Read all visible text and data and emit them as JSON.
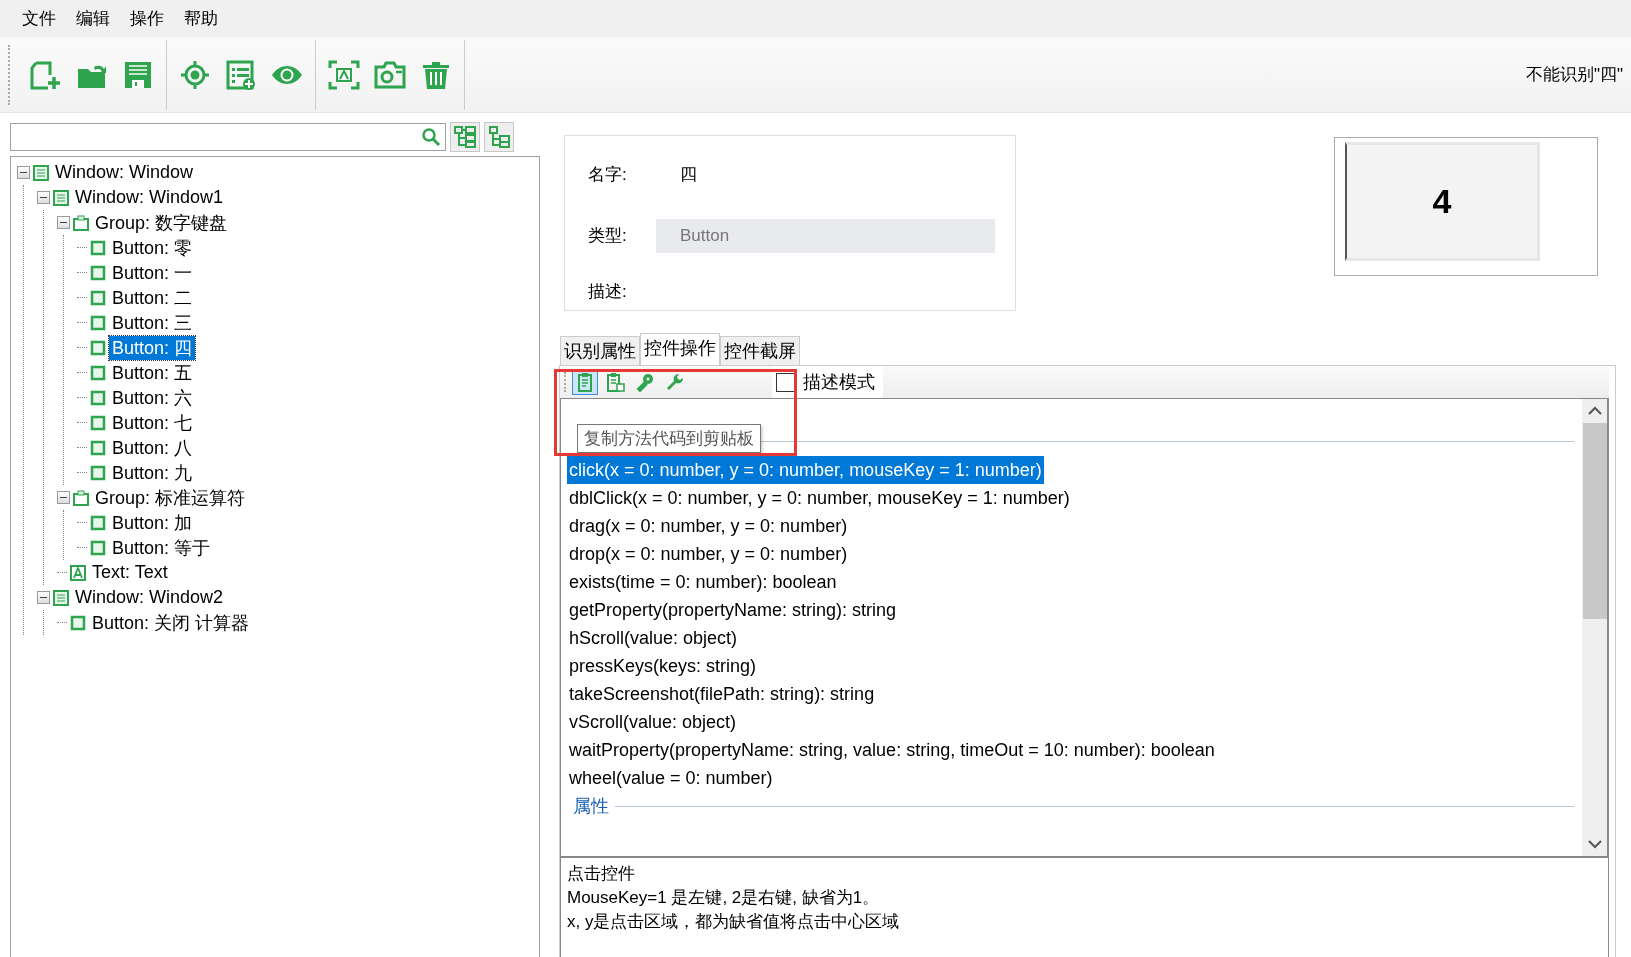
{
  "menu": [
    {
      "label": "文件"
    },
    {
      "label": "编辑"
    },
    {
      "label": "操作"
    },
    {
      "label": "帮助"
    }
  ],
  "status_text": "不能识别\"四\"",
  "tree": [
    {
      "label": "Window: Window",
      "kind": "window",
      "expanded": true,
      "selected": false,
      "children": [
        {
          "label": "Window: Window1",
          "kind": "window",
          "expanded": true,
          "selected": false,
          "children": [
            {
              "label": "Group: 数字键盘",
              "kind": "group",
              "expanded": true,
              "selected": false,
              "children": [
                {
                  "label": "Button: 零",
                  "kind": "button",
                  "selected": false
                },
                {
                  "label": "Button: 一",
                  "kind": "button",
                  "selected": false
                },
                {
                  "label": "Button: 二",
                  "kind": "button",
                  "selected": false
                },
                {
                  "label": "Button: 三",
                  "kind": "button",
                  "selected": false
                },
                {
                  "label": "Button: 四",
                  "kind": "button",
                  "selected": true
                },
                {
                  "label": "Button: 五",
                  "kind": "button",
                  "selected": false
                },
                {
                  "label": "Button: 六",
                  "kind": "button",
                  "selected": false
                },
                {
                  "label": "Button: 七",
                  "kind": "button",
                  "selected": false
                },
                {
                  "label": "Button: 八",
                  "kind": "button",
                  "selected": false
                },
                {
                  "label": "Button: 九",
                  "kind": "button",
                  "selected": false
                }
              ]
            },
            {
              "label": "Group: 标准运算符",
              "kind": "group",
              "expanded": true,
              "selected": false,
              "children": [
                {
                  "label": "Button: 加",
                  "kind": "button",
                  "selected": false
                },
                {
                  "label": "Button: 等于",
                  "kind": "button",
                  "selected": false
                }
              ]
            },
            {
              "label": "Text: Text",
              "kind": "text",
              "selected": false
            }
          ]
        },
        {
          "label": "Window: Window2",
          "kind": "window",
          "expanded": true,
          "selected": false,
          "children": [
            {
              "label": "Button: 关闭 计算器",
              "kind": "button",
              "selected": false
            }
          ]
        }
      ]
    }
  ],
  "details": {
    "name_label": "名字:",
    "name_value": "四",
    "type_label": "类型:",
    "type_value": "Button",
    "desc_label": "描述:"
  },
  "preview": {
    "caption": "4"
  },
  "tabs": [
    {
      "label": "识别属性",
      "selected": false
    },
    {
      "label": "控件操作",
      "selected": true
    },
    {
      "label": "控件截屏",
      "selected": false
    }
  ],
  "method_tools": [
    {
      "hovered": true
    },
    {
      "hovered": false
    },
    {
      "hovered": false
    },
    {
      "hovered": false
    }
  ],
  "describe_mode": {
    "label": "描述模式",
    "checked": false
  },
  "tooltip": "复制方法代码到剪贴板",
  "methods": [
    {
      "text": "click(x = 0: number, y = 0: number, mouseKey = 1: number)",
      "selected": true
    },
    {
      "text": "dblClick(x = 0: number, y = 0: number, mouseKey = 1: number)",
      "selected": false
    },
    {
      "text": "drag(x = 0: number, y = 0: number)",
      "selected": false
    },
    {
      "text": "drop(x = 0: number, y = 0: number)",
      "selected": false
    },
    {
      "text": "exists(time = 0: number): boolean",
      "selected": false
    },
    {
      "text": "getProperty(propertyName: string): string",
      "selected": false
    },
    {
      "text": "hScroll(value: object)",
      "selected": false
    },
    {
      "text": "pressKeys(keys: string)",
      "selected": false
    },
    {
      "text": "takeScreenshot(filePath: string): string",
      "selected": false
    },
    {
      "text": "vScroll(value: object)",
      "selected": false
    },
    {
      "text": "waitProperty(propertyName: string, value: string, timeOut = 10: number): boolean",
      "selected": false
    },
    {
      "text": "wheel(value = 0: number)",
      "selected": false
    }
  ],
  "properties_header": "属性",
  "description_lines": [
    "点击控件",
    "MouseKey=1 是左键, 2是右键, 缺省为1。",
    "x, y是点击区域，都为缺省值将点击中心区域"
  ]
}
